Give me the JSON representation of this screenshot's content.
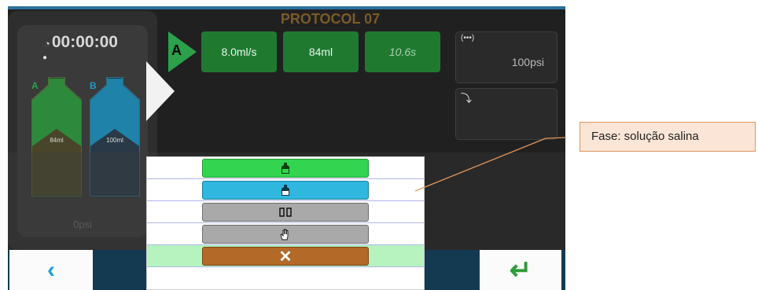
{
  "protocol_title": "PROTOCOL 07",
  "status": {
    "timer": "00:00:00",
    "bottle_a_label": "A",
    "bottle_b_label": "B",
    "bottle_a_volume": "84ml",
    "bottle_b_volume": "100ml",
    "pressure": "0psi"
  },
  "phase": {
    "marker": "A",
    "flow_rate": "8.0ml/s",
    "volume": "84ml",
    "duration": "10.6s"
  },
  "side": {
    "pressure_limit": "100psi"
  },
  "menu": {
    "options": [
      {
        "icon": "contrast-bottle-icon",
        "glyph": "🜄"
      },
      {
        "icon": "saline-bottle-icon",
        "glyph": "🜄"
      },
      {
        "icon": "pause-icon",
        "glyph": "▯▯"
      },
      {
        "icon": "hand-icon",
        "glyph": "☝"
      },
      {
        "icon": "close-icon",
        "glyph": "✕"
      }
    ]
  },
  "nav": {
    "back_glyph": "‹",
    "enter_glyph": "↵"
  },
  "callout": {
    "text": "Fase: solução salina"
  },
  "colors": {
    "contrast": "#33d44f",
    "saline": "#2fb7df",
    "neutral": "#a9a9a9",
    "cancel": "#b36a28",
    "selected_row": "#b6f3bf",
    "callout_bg": "#fbe5d6",
    "callout_border": "#e3965e"
  }
}
